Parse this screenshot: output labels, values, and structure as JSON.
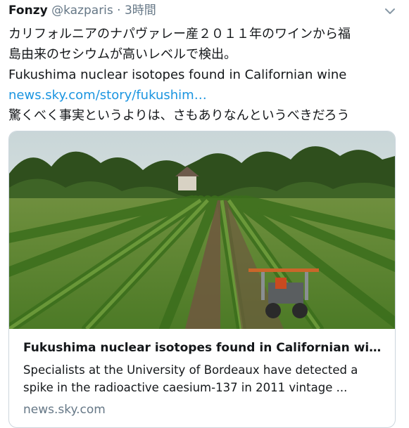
{
  "tweet": {
    "author_name": "Fonzy",
    "author_handle": "@kazparis",
    "separator": "·",
    "time": "3時間",
    "text_line1": "カリフォルニアのナパヴァレー産２０１１年のワインから福",
    "text_line2": "島由来のセシウムが高いレベルで検出。",
    "text_line3": "Fukushima nuclear isotopes found in Californian wine",
    "link": "news.sky.com/story/fukushim…",
    "text_line4": "驚くべく事実というよりは、さもありなんというべきだろう"
  },
  "card": {
    "title": "Fukushima nuclear isotopes found in Californian wi…",
    "description_line1": "Specialists at the University of Bordeaux have detected a",
    "description_line2": "spike in the radioactive caesium-137 in 2011 vintage ...",
    "domain": "news.sky.com"
  },
  "icons": {
    "menu": "chevron-down-icon"
  },
  "colors": {
    "link": "#1b95e0",
    "muted": "#657786",
    "border": "#ccd6dd"
  }
}
